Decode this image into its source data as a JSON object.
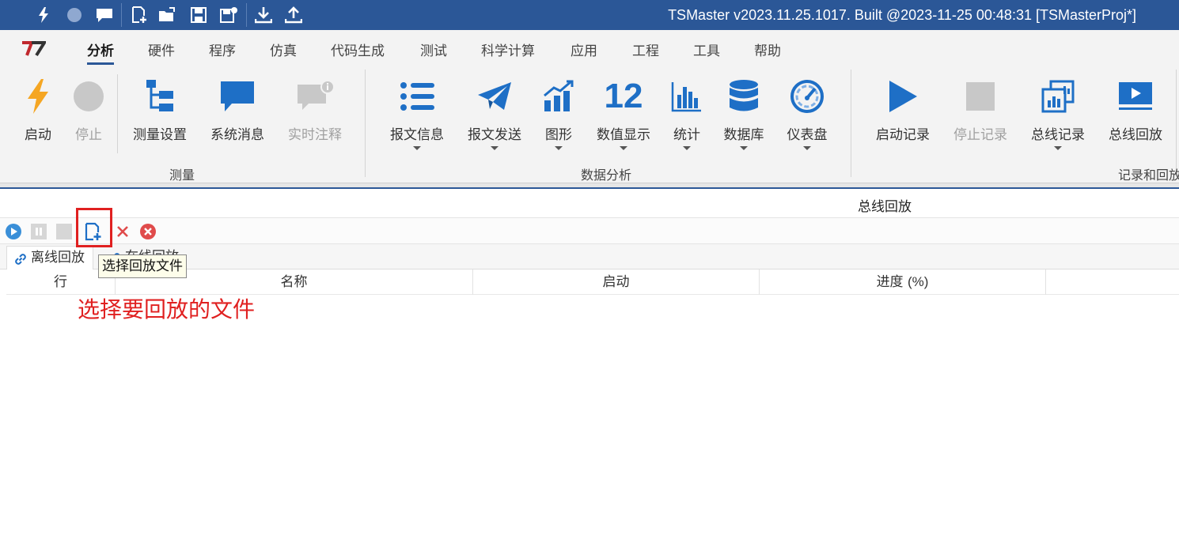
{
  "window": {
    "title": "TSMaster v2023.11.25.1017. Built @2023-11-25 00:48:31 [TSMasterProj*]",
    "quick_access_icons": [
      "lightning-icon",
      "record-dot-icon",
      "chat-icon",
      "new-file-icon",
      "open-folder-icon",
      "save-icon",
      "save-as-icon",
      "download-icon",
      "upload-icon"
    ]
  },
  "menu": {
    "logo_text": "T7",
    "items": [
      "分析",
      "硬件",
      "程序",
      "仿真",
      "代码生成",
      "测试",
      "科学计算",
      "应用",
      "工程",
      "工具",
      "帮助"
    ],
    "active_index": 0
  },
  "ribbon": {
    "groups": {
      "measure": {
        "label": "测量",
        "buttons": [
          {
            "label": "启动",
            "icon": "lightning-icon",
            "enabled": true
          },
          {
            "label": "停止",
            "icon": "stop-circle-icon",
            "enabled": false
          },
          {
            "label": "测量设置",
            "icon": "tree-icon",
            "enabled": true
          },
          {
            "label": "系统消息",
            "icon": "message-icon",
            "enabled": true
          },
          {
            "label": "实时注释",
            "icon": "comment-info-icon",
            "enabled": false
          }
        ]
      },
      "analysis": {
        "label": "数据分析",
        "buttons": [
          {
            "label": "报文信息",
            "icon": "list-icon",
            "dropdown": true
          },
          {
            "label": "报文发送",
            "icon": "send-icon",
            "dropdown": true
          },
          {
            "label": "图形",
            "icon": "chart-trend-icon",
            "dropdown": true
          },
          {
            "label": "数值显示",
            "icon": "number-display-icon",
            "glyph": "12",
            "dropdown": true
          },
          {
            "label": "统计",
            "icon": "bar-stats-icon",
            "dropdown": true
          },
          {
            "label": "数据库",
            "icon": "database-icon",
            "dropdown": true
          },
          {
            "label": "仪表盘",
            "icon": "gauge-icon",
            "dropdown": true
          }
        ]
      },
      "record": {
        "label": "记录和回放",
        "buttons": [
          {
            "label": "启动记录",
            "icon": "play-icon",
            "enabled": true
          },
          {
            "label": "停止记录",
            "icon": "stop-square-icon",
            "enabled": false
          },
          {
            "label": "总线记录",
            "icon": "bus-record-icon",
            "dropdown": true
          },
          {
            "label": "总线回放",
            "icon": "bus-replay-icon",
            "enabled": true
          }
        ]
      }
    }
  },
  "panel": {
    "title": "总线回放",
    "toolbar": [
      "play-icon",
      "pause-icon",
      "stop-icon",
      "add-file-icon",
      "delete-icon",
      "clear-all-icon"
    ],
    "tabs": [
      {
        "label": "离线回放",
        "icon": "link-icon",
        "active": true
      },
      {
        "label": "在线回放",
        "icon": "link-icon",
        "active": false
      }
    ],
    "tooltip": "选择回放文件",
    "columns": {
      "row": "行",
      "name": "名称",
      "start": "启动",
      "progress": "进度",
      "progress_unit": "(%)"
    }
  },
  "annotation": "选择要回放的文件",
  "colors": {
    "titlebar": "#2b5797",
    "accent_blue": "#1e6fc6",
    "highlight_red": "#e02020",
    "lightning_orange": "#f5a623",
    "disabled_gray": "#c8c8c8"
  }
}
